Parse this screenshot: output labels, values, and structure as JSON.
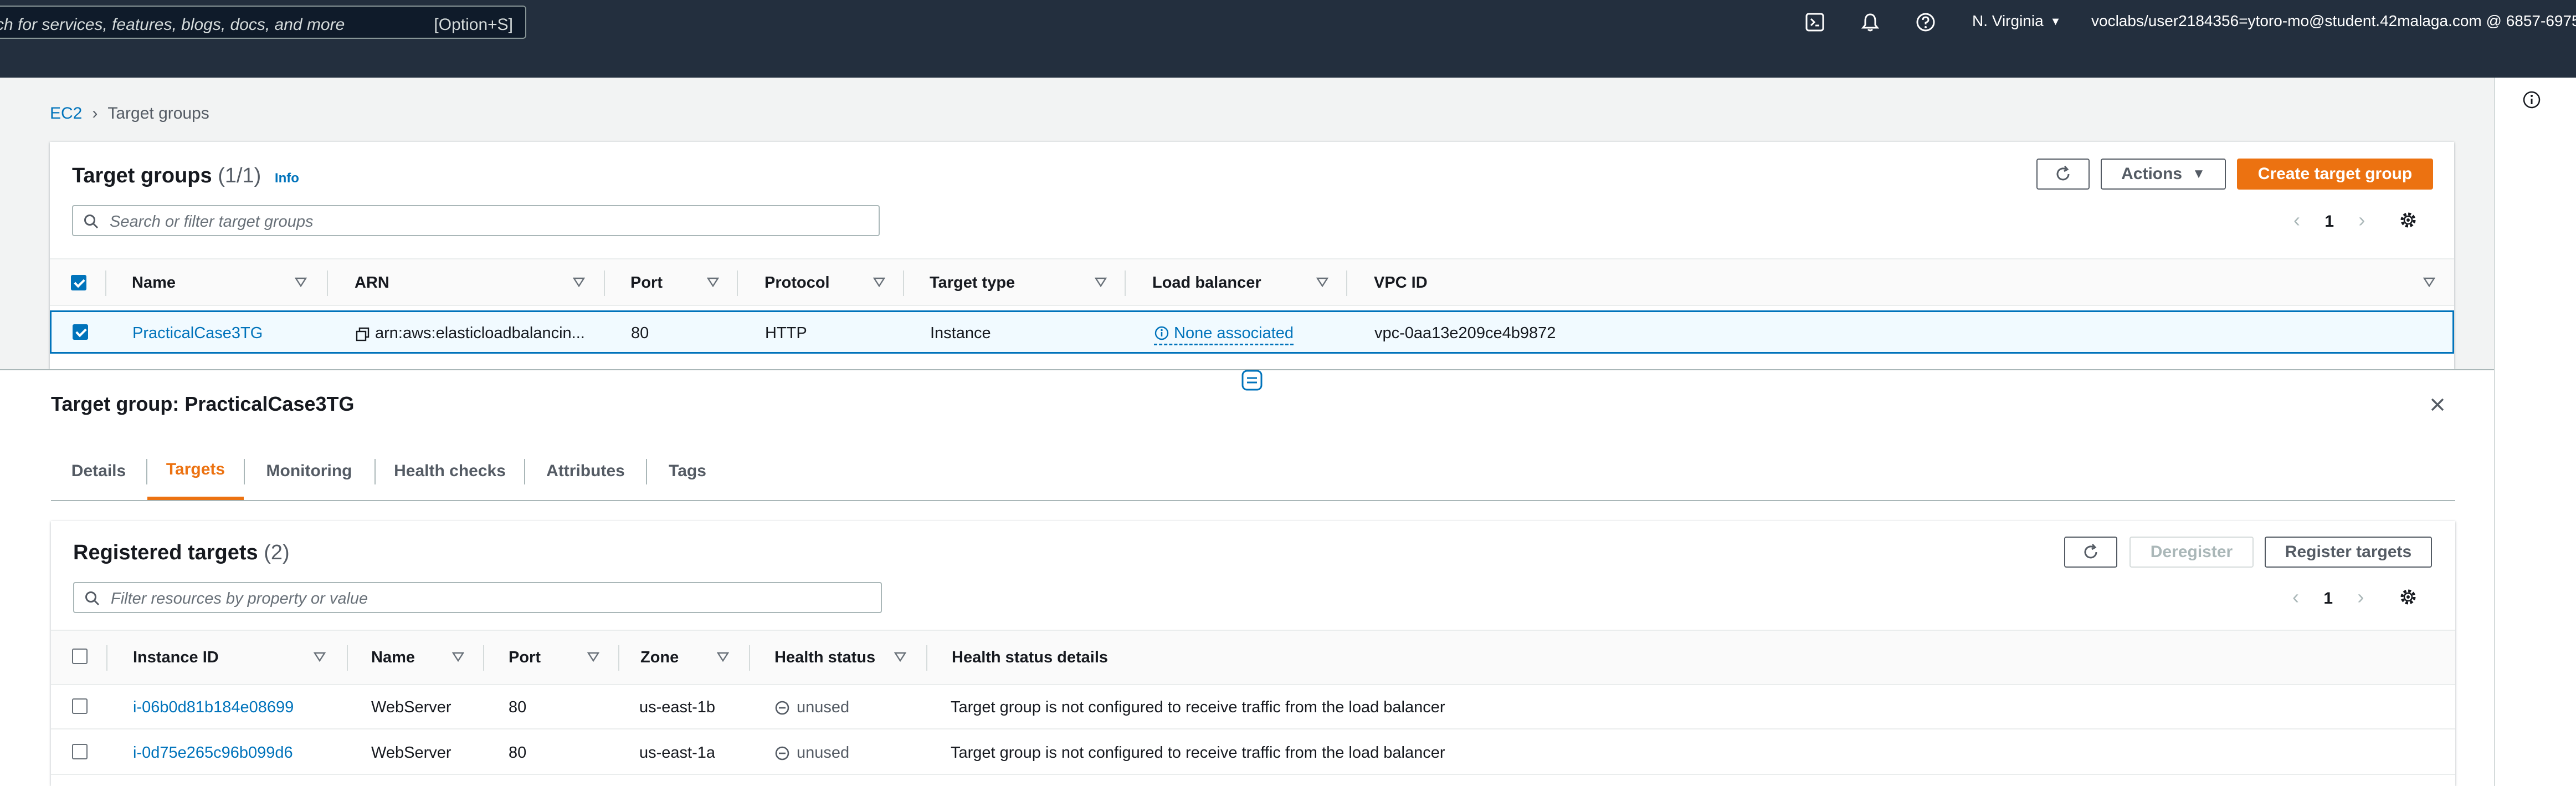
{
  "topnav": {
    "search_placeholder": "ch for services, features, blogs, docs, and more",
    "search_shortcut": "[Option+S]",
    "region": "N. Virginia",
    "account": "voclabs/user2184356=ytoro-mo@student.42malaga.com @ 6857-6975...",
    "icons": [
      "cloudshell-icon",
      "bell-icon",
      "help-icon"
    ]
  },
  "breadcrumb": {
    "root": "EC2",
    "current": "Target groups"
  },
  "target_groups": {
    "title": "Target groups",
    "count": "(1/1)",
    "info": "Info",
    "actions_label": "Actions",
    "create_label": "Create target group",
    "search_placeholder": "Search or filter target groups",
    "page": "1",
    "columns": [
      "Name",
      "ARN",
      "Port",
      "Protocol",
      "Target type",
      "Load balancer",
      "VPC ID"
    ],
    "rows": [
      {
        "name": "PracticalCase3TG",
        "arn": "arn:aws:elasticloadbalancin...",
        "port": "80",
        "protocol": "HTTP",
        "target_type": "Instance",
        "load_balancer": "None associated",
        "vpc_id": "vpc-0aa13e209ce4b9872",
        "selected": true
      }
    ]
  },
  "detail": {
    "title": "Target group: PracticalCase3TG",
    "tabs": [
      {
        "label": "Details"
      },
      {
        "label": "Targets"
      },
      {
        "label": "Monitoring"
      },
      {
        "label": "Health checks"
      },
      {
        "label": "Attributes"
      },
      {
        "label": "Tags"
      }
    ],
    "active_tab": "Targets"
  },
  "registered": {
    "title": "Registered targets",
    "count": "(2)",
    "deregister_label": "Deregister",
    "register_label": "Register targets",
    "filter_placeholder": "Filter resources by property or value",
    "page": "1",
    "columns": [
      "Instance ID",
      "Name",
      "Port",
      "Zone",
      "Health status",
      "Health status details"
    ],
    "rows": [
      {
        "instance_id": "i-06b0d81b184e08699",
        "name": "WebServer",
        "port": "80",
        "zone": "us-east-1b",
        "health": "unused",
        "details": "Target group is not configured to receive traffic from the load balancer"
      },
      {
        "instance_id": "i-0d75e265c96b099d6",
        "name": "WebServer",
        "port": "80",
        "zone": "us-east-1a",
        "health": "unused",
        "details": "Target group is not configured to receive traffic from the load balancer"
      }
    ]
  },
  "colors": {
    "nav_bg": "#232f3e",
    "link": "#0073bb",
    "accent": "#ec7211",
    "selected_row": "#f1faff"
  }
}
